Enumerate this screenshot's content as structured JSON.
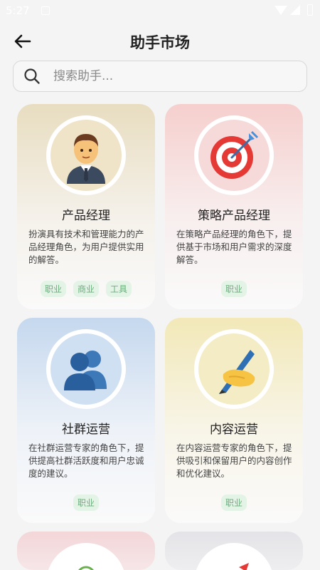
{
  "status": {
    "time": "5:27"
  },
  "header": {
    "title": "助手市场"
  },
  "search": {
    "placeholder": "搜索助手..."
  },
  "cards": [
    {
      "name": "产品经理",
      "desc": "扮演具有技术和管理能力的产品经理角色，为用户提供实用的解答。",
      "tags": [
        "职业",
        "商业",
        "工具"
      ],
      "icon": "businessman-icon"
    },
    {
      "name": "策略产品经理",
      "desc": "在策略产品经理的角色下，提供基于市场和用户需求的深度解答。",
      "tags": [
        "职业"
      ],
      "icon": "target-icon"
    },
    {
      "name": "社群运营",
      "desc": "在社群运营专家的角色下，提供提高社群活跃度和用户忠诚度的建议。",
      "tags": [
        "职业"
      ],
      "icon": "people-icon"
    },
    {
      "name": "内容运营",
      "desc": "在内容运营专家的角色下，提供吸引和保留用户的内容创作和优化建议。",
      "tags": [
        "职业"
      ],
      "icon": "writing-hand-icon"
    }
  ]
}
